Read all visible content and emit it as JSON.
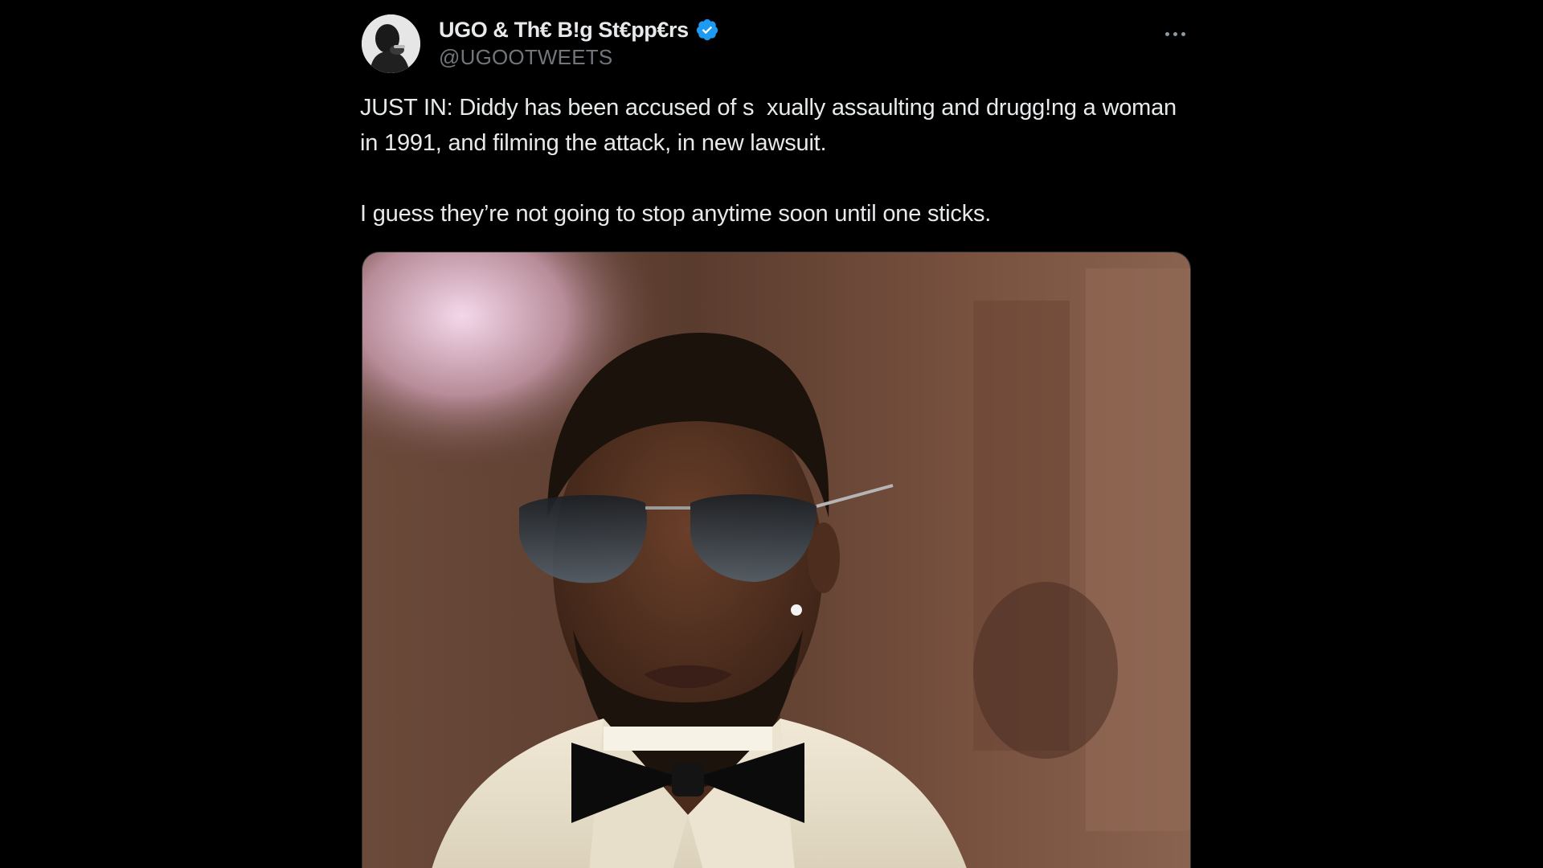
{
  "tweet": {
    "display_name": "UGO & Th€ B!g St€pp€rs",
    "handle": "@UGOOTWEETS",
    "verified_icon": "verified-badge-icon",
    "more_icon": "more-options-icon",
    "body_line1": "JUST IN: Diddy has been accused of s  xually assaulting and drugg!ng a woman in 1991, and filming the attack, in new lawsuit.",
    "body_line2": "I guess they’re not going to stop anytime soon until one sticks.",
    "media_description_icon": "photo-icon"
  },
  "colors": {
    "background": "#000000",
    "text_primary": "#e7e9ea",
    "text_secondary": "#71767b",
    "verified_blue": "#1d9bf0"
  }
}
